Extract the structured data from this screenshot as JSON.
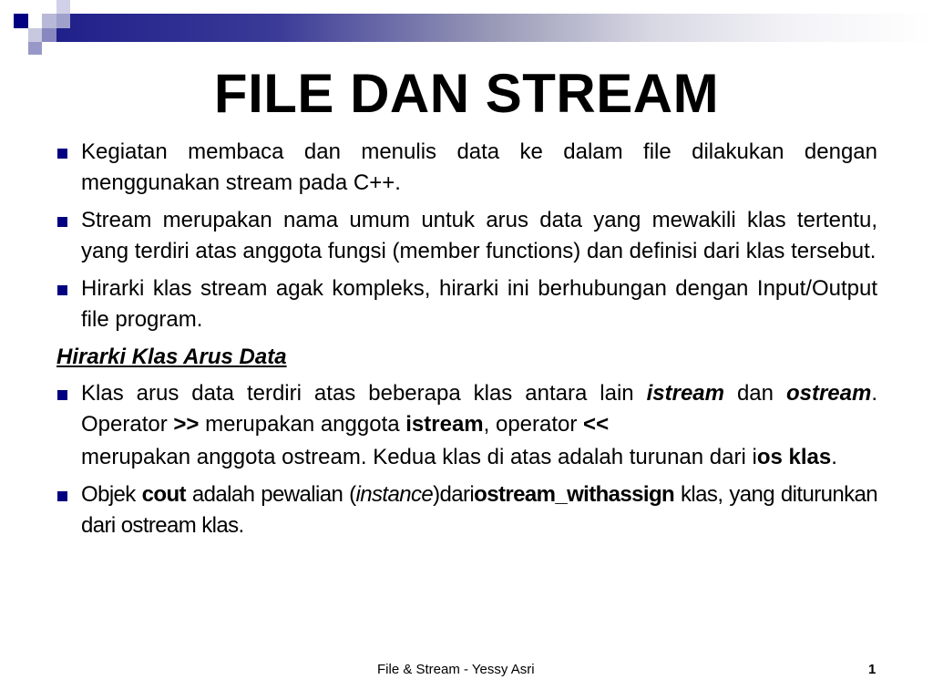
{
  "slide": {
    "title": "FILE DAN STREAM",
    "accent_color": "#000080",
    "bullets": [
      {
        "parts": [
          "Kegiatan membaca dan menulis data ke dalam file dilakukan dengan menggunakan stream pada C++."
        ]
      },
      {
        "parts": [
          "Stream merupakan nama umum untuk arus data yang mewakili klas tertentu, yang terdiri atas anggota fungsi (member functions) dan definisi dari klas tersebut."
        ]
      },
      {
        "parts": [
          "Hirarki klas stream agak kompleks, hirarki ini berhubungan dengan Input/Output file program."
        ]
      }
    ],
    "section_heading": "Hirarki Klas Arus Data",
    "bullet4": {
      "t1": "Klas arus data terdiri atas beberapa klas antara lain ",
      "istream_italic": "istream",
      "t2": " dan ",
      "ostream_italic": "ostream",
      "t3": ". Operator ",
      "op_in": ">>",
      "t4": " merupakan anggota ",
      "istream_bold": "istream",
      "t5": ", operator ",
      "op_out": "<<",
      "cont1": "merupakan anggota ostream. Kedua klas di atas adalah turunan dari i",
      "ios_bold": "os klas",
      "cont2": "."
    },
    "bullet5": {
      "t1": "Objek ",
      "cout": "cout",
      "t2": " adalah pewalian (",
      "instance": "instance",
      "t3": ")dari",
      "owa": "ostream_withassign",
      "t4": " klas, yang diturunkan dari ostream klas."
    }
  },
  "footer": {
    "text": "File & Stream - Yessy Asri",
    "page_number": "1"
  }
}
